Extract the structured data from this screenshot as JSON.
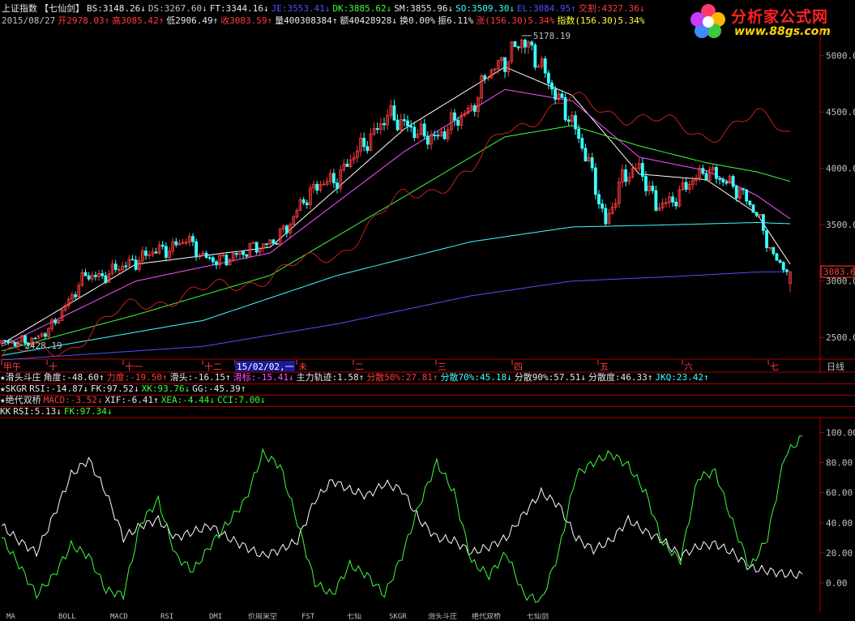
{
  "header": {
    "line1": [
      {
        "t": "上证指数",
        "c": "white"
      },
      {
        "t": "【七仙剑】",
        "c": "white"
      },
      {
        "t": "BS:3148.26↓",
        "c": "white"
      },
      {
        "t": "DS:3267.60↓",
        "c": "gray"
      },
      {
        "t": "FT:3344.16↓",
        "c": "white"
      },
      {
        "t": "JE:3553.41↓",
        "c": "blue"
      },
      {
        "t": "DK:3885.62↓",
        "c": "green"
      },
      {
        "t": "SM:3855.96↓",
        "c": "white"
      },
      {
        "t": "SO:3509.30↓",
        "c": "cyan"
      },
      {
        "t": "EL:3084.95↑",
        "c": "blue"
      },
      {
        "t": "交割:4327.36↓",
        "c": "red"
      }
    ],
    "line2": [
      {
        "t": "2015/08/27",
        "c": "gray"
      },
      {
        "t": "开2978.03↑",
        "c": "red"
      },
      {
        "t": "高3085.42↑",
        "c": "red"
      },
      {
        "t": "低2906.49↑",
        "c": "white"
      },
      {
        "t": "收3083.59↑",
        "c": "red"
      },
      {
        "t": "量400308384↑",
        "c": "white"
      },
      {
        "t": "额40428928↓",
        "c": "white"
      },
      {
        "t": "换0.00%",
        "c": "white"
      },
      {
        "t": "振6.11%",
        "c": "white"
      },
      {
        "t": "涨(156.30)5.34%",
        "c": "red"
      },
      {
        "t": "指数(156.30)5.34%",
        "c": "yellow"
      }
    ]
  },
  "logo": {
    "title": "分析家公式网",
    "url": "www.88gs.com"
  },
  "price_axis": {
    "labels": [
      "5000.0",
      "4500.0",
      "4000.0",
      "3500.0",
      "3000.0",
      "2500.0"
    ],
    "current": "3083.6"
  },
  "annotations": {
    "high": "5178.19",
    "low": "2428.19"
  },
  "time_axis": {
    "labels": [
      "甲午",
      "十",
      "十一",
      "十二",
      "15/02/02,一",
      "未",
      "二",
      "三",
      "四",
      "五",
      "六",
      "七"
    ],
    "right_label": "日线"
  },
  "indicator_rows": [
    [
      {
        "t": "★滑头斗庄",
        "c": "white"
      },
      {
        "t": "角度:-48.60↑",
        "c": "white"
      },
      {
        "t": "力度:-19.50↑",
        "c": "red"
      },
      {
        "t": "滑头:-16.15↑",
        "c": "white"
      },
      {
        "t": "滑标:-15.41↓",
        "c": "magenta"
      },
      {
        "t": "主力轨迹:1.58↑",
        "c": "white"
      },
      {
        "t": "分散50%:27.81↑",
        "c": "red"
      },
      {
        "t": "分散70%:45.18↓",
        "c": "cyan"
      },
      {
        "t": "分散90%:57.51↓",
        "c": "white"
      },
      {
        "t": "分散度:46.33↑",
        "c": "white"
      },
      {
        "t": "JKQ:23.42↑",
        "c": "cyan"
      }
    ],
    [
      {
        "t": "★SKGR",
        "c": "white"
      },
      {
        "t": "RSI:-14.87↓",
        "c": "white"
      },
      {
        "t": "FK:97.52↓",
        "c": "white"
      },
      {
        "t": "XK:93.76↓",
        "c": "green"
      },
      {
        "t": "GG:-45.39↑",
        "c": "white"
      }
    ],
    [
      {
        "t": "★绝代双桥",
        "c": "white"
      },
      {
        "t": "MACD:-3.52↓",
        "c": "red"
      },
      {
        "t": "XIF:-6.41↑",
        "c": "white"
      },
      {
        "t": "XEA:-4.44↓",
        "c": "green"
      },
      {
        "t": "CCI:7.00↓",
        "c": "green"
      }
    ],
    [
      {
        "t": "KK",
        "c": "white"
      },
      {
        "t": "RSI:5.13↓",
        "c": "white"
      },
      {
        "t": "FK:97.34↓",
        "c": "green"
      }
    ]
  ],
  "osc_axis": {
    "labels": [
      "100.00",
      "80.00",
      "60.00",
      "40.00",
      "20.00",
      "0.00"
    ]
  },
  "bottom_tabs": [
    "MA",
    "BOLL",
    "MACD",
    "RSI",
    "DMI",
    "价周采空",
    "FST",
    "七仙",
    "SKGR",
    "滑头斗庄",
    "绝代双桥",
    "七仙剑"
  ],
  "chart_data": [
    {
      "type": "candlestick",
      "title": "上证指数",
      "period": "日线",
      "ylim": [
        2300,
        5250
      ],
      "x_range": [
        "2014/07",
        "2015/08/27"
      ],
      "last": {
        "open": 2978.03,
        "high": 3085.42,
        "low": 2906.49,
        "close": 3083.59
      },
      "markers": {
        "high": 5178.19,
        "low": 2428.19
      },
      "close_path": [
        [
          0,
          2450
        ],
        [
          5,
          2460
        ],
        [
          10,
          2480
        ],
        [
          15,
          2600
        ],
        [
          20,
          2820
        ],
        [
          25,
          3060
        ],
        [
          30,
          3030
        ],
        [
          35,
          3130
        ],
        [
          40,
          3170
        ],
        [
          45,
          3270
        ],
        [
          50,
          3280
        ],
        [
          55,
          3380
        ],
        [
          60,
          3210
        ],
        [
          65,
          3180
        ],
        [
          70,
          3230
        ],
        [
          75,
          3300
        ],
        [
          80,
          3330
        ],
        [
          85,
          3470
        ],
        [
          90,
          3720
        ],
        [
          95,
          3870
        ],
        [
          100,
          3900
        ],
        [
          105,
          4130
        ],
        [
          110,
          4270
        ],
        [
          115,
          4480
        ],
        [
          120,
          4390
        ],
        [
          125,
          4300
        ],
        [
          130,
          4270
        ],
        [
          135,
          4430
        ],
        [
          140,
          4520
        ],
        [
          145,
          4860
        ],
        [
          150,
          4950
        ],
        [
          155,
          5150
        ],
        [
          160,
          4950
        ],
        [
          165,
          4660
        ],
        [
          170,
          4410
        ],
        [
          175,
          4050
        ],
        [
          180,
          3500
        ],
        [
          185,
          3920
        ],
        [
          190,
          4010
        ],
        [
          195,
          3670
        ],
        [
          200,
          3710
        ],
        [
          205,
          3880
        ],
        [
          210,
          3980
        ],
        [
          215,
          3900
        ],
        [
          220,
          3800
        ],
        [
          225,
          3600
        ],
        [
          230,
          3210
        ],
        [
          235,
          3083
        ]
      ],
      "ma_lines": [
        {
          "name": "SM",
          "color": "#ffffff",
          "values": [
            [
              0,
              2440
            ],
            [
              40,
              3150
            ],
            [
              80,
              3300
            ],
            [
              120,
              4350
            ],
            [
              150,
              4900
            ],
            [
              170,
              4650
            ],
            [
              190,
              3950
            ],
            [
              210,
              3900
            ],
            [
              225,
              3600
            ],
            [
              235,
              3150
            ]
          ]
        },
        {
          "name": "JE",
          "color": "#ff50ff",
          "values": [
            [
              0,
              2420
            ],
            [
              40,
              3000
            ],
            [
              80,
              3250
            ],
            [
              120,
              4150
            ],
            [
              150,
              4700
            ],
            [
              170,
              4600
            ],
            [
              190,
              4100
            ],
            [
              210,
              3980
            ],
            [
              225,
              3760
            ],
            [
              235,
              3553
            ]
          ]
        },
        {
          "name": "DK",
          "color": "#3cff3c",
          "values": [
            [
              0,
              2380
            ],
            [
              40,
              2700
            ],
            [
              80,
              3050
            ],
            [
              120,
              3750
            ],
            [
              150,
              4280
            ],
            [
              170,
              4380
            ],
            [
              190,
              4200
            ],
            [
              210,
              4050
            ],
            [
              225,
              3970
            ],
            [
              235,
              3885
            ]
          ]
        },
        {
          "name": "SO",
          "color": "#3cffff",
          "values": [
            [
              0,
              2340
            ],
            [
              60,
              2650
            ],
            [
              100,
              3050
            ],
            [
              140,
              3350
            ],
            [
              170,
              3480
            ],
            [
              200,
              3500
            ],
            [
              225,
              3520
            ],
            [
              235,
              3509
            ]
          ]
        },
        {
          "name": "EL",
          "color": "#5050ff",
          "values": [
            [
              0,
              2300
            ],
            [
              60,
              2420
            ],
            [
              100,
              2620
            ],
            [
              140,
              2870
            ],
            [
              170,
              3000
            ],
            [
              200,
              3040
            ],
            [
              225,
              3080
            ],
            [
              235,
              3084
            ]
          ]
        },
        {
          "name": "交割",
          "color": "#c81e1e",
          "values": [
            [
              0,
              2330
            ],
            [
              20,
              2420
            ],
            [
              40,
              2800
            ],
            [
              60,
              2900
            ],
            [
              80,
              3050
            ],
            [
              100,
              3250
            ],
            [
              120,
              3750
            ],
            [
              140,
              3950
            ],
            [
              150,
              4350
            ],
            [
              170,
              4600
            ],
            [
              190,
              4450
            ],
            [
              210,
              4300
            ],
            [
              225,
              4450
            ],
            [
              235,
              4327
            ]
          ]
        }
      ]
    },
    {
      "type": "line",
      "title": "KK",
      "ylim": [
        -20,
        110
      ],
      "series": [
        {
          "name": "RSI",
          "color": "#ffffff",
          "values": [
            38,
            28,
            20,
            45,
            72,
            82,
            60,
            30,
            38,
            42,
            30,
            34,
            38,
            30,
            24,
            18,
            22,
            28,
            55,
            68,
            62,
            58,
            66,
            62,
            42,
            30,
            28,
            20,
            24,
            30,
            46,
            60,
            52,
            30,
            22,
            28,
            42,
            34,
            28,
            18,
            24,
            26,
            20,
            10,
            8,
            6,
            5
          ]
        },
        {
          "name": "FK",
          "color": "#3cff3c",
          "values": [
            30,
            12,
            -8,
            5,
            25,
            18,
            -5,
            -8,
            40,
            55,
            18,
            8,
            25,
            40,
            55,
            86,
            78,
            40,
            0,
            -8,
            12,
            5,
            -8,
            18,
            52,
            80,
            60,
            14,
            5,
            20,
            -8,
            -12,
            20,
            72,
            80,
            86,
            78,
            60,
            26,
            15,
            70,
            74,
            40,
            10,
            30,
            85,
            97
          ]
        }
      ]
    }
  ]
}
